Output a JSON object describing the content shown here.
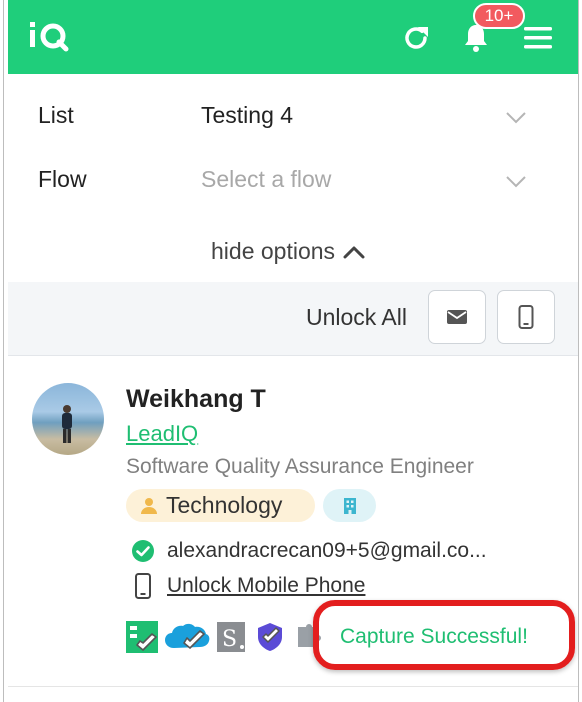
{
  "header": {
    "logo": "iQ",
    "notifications_badge": "10+",
    "bg_color": "#1fce7b"
  },
  "options": {
    "list_label": "List",
    "list_value": "Testing 4",
    "flow_label": "Flow",
    "flow_placeholder": "Select a flow",
    "hide_options": "hide options"
  },
  "unlock": {
    "label": "Unlock All",
    "email_icon": "mail-icon",
    "phone_icon": "mobile-phone-icon"
  },
  "contact": {
    "name": "Weikhang T",
    "company": "LeadIQ",
    "title": "Software Quality Assurance Engineer",
    "industry": "Technology",
    "email": "alexandracrecan09+5@gmail.co...",
    "phone_action": "Unlock Mobile Phone",
    "integrations": [
      "checklist-icon",
      "salesforce-icon",
      "salesloft-icon",
      "outreach-icon",
      "puzzle-icon"
    ],
    "status": "Capture Successful!",
    "status_color": "#1fbe72"
  }
}
